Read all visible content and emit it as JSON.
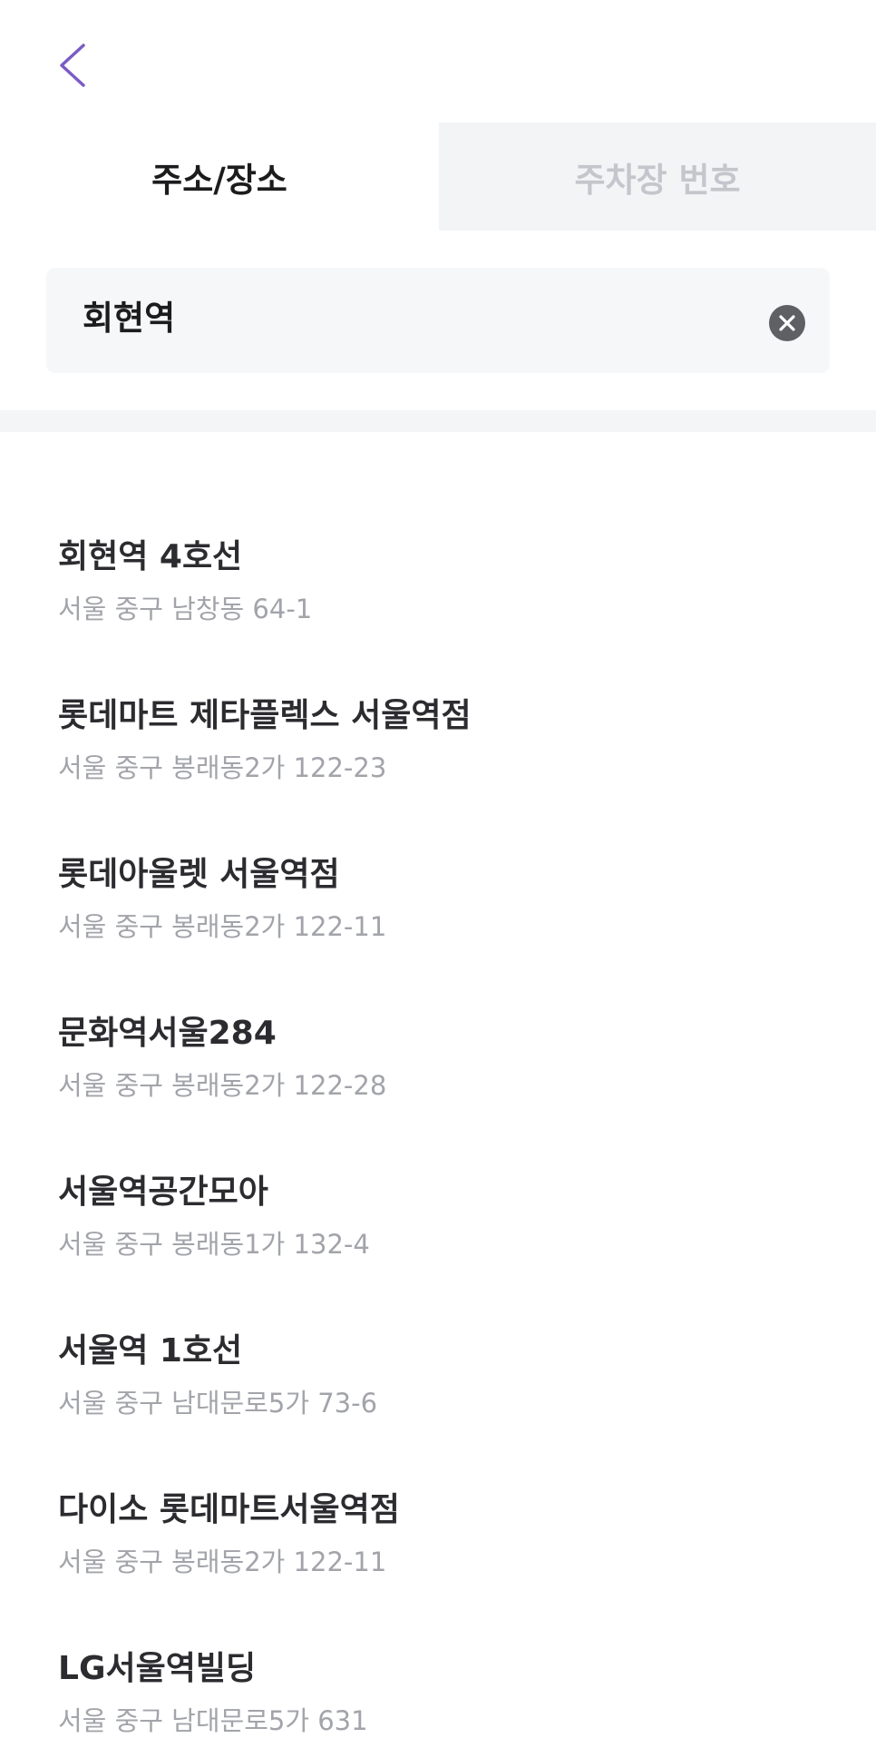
{
  "header": {
    "back_icon": "chevron-left-icon",
    "accent_color": "#7b5cc4"
  },
  "tabs": [
    {
      "label": "주소/장소",
      "active": true
    },
    {
      "label": "주차장 번호",
      "active": false
    }
  ],
  "search": {
    "value": "회현역",
    "clear_icon": "clear-circle-icon"
  },
  "results": [
    {
      "name": "회현역 4호선",
      "address": "서울 중구 남창동 64-1"
    },
    {
      "name": "롯데마트 제타플렉스 서울역점",
      "address": "서울 중구 봉래동2가 122-23"
    },
    {
      "name": "롯데아울렛 서울역점",
      "address": "서울 중구 봉래동2가 122-11"
    },
    {
      "name": "문화역서울284",
      "address": "서울 중구 봉래동2가 122-28"
    },
    {
      "name": "서울역공간모아",
      "address": "서울 중구 봉래동1가 132-4"
    },
    {
      "name": "서울역 1호선",
      "address": "서울 중구 남대문로5가 73-6"
    },
    {
      "name": "다이소 롯데마트서울역점",
      "address": "서울 중구 봉래동2가 122-11"
    },
    {
      "name": "LG서울역빌딩",
      "address": "서울 중구 남대문로5가 631"
    }
  ]
}
